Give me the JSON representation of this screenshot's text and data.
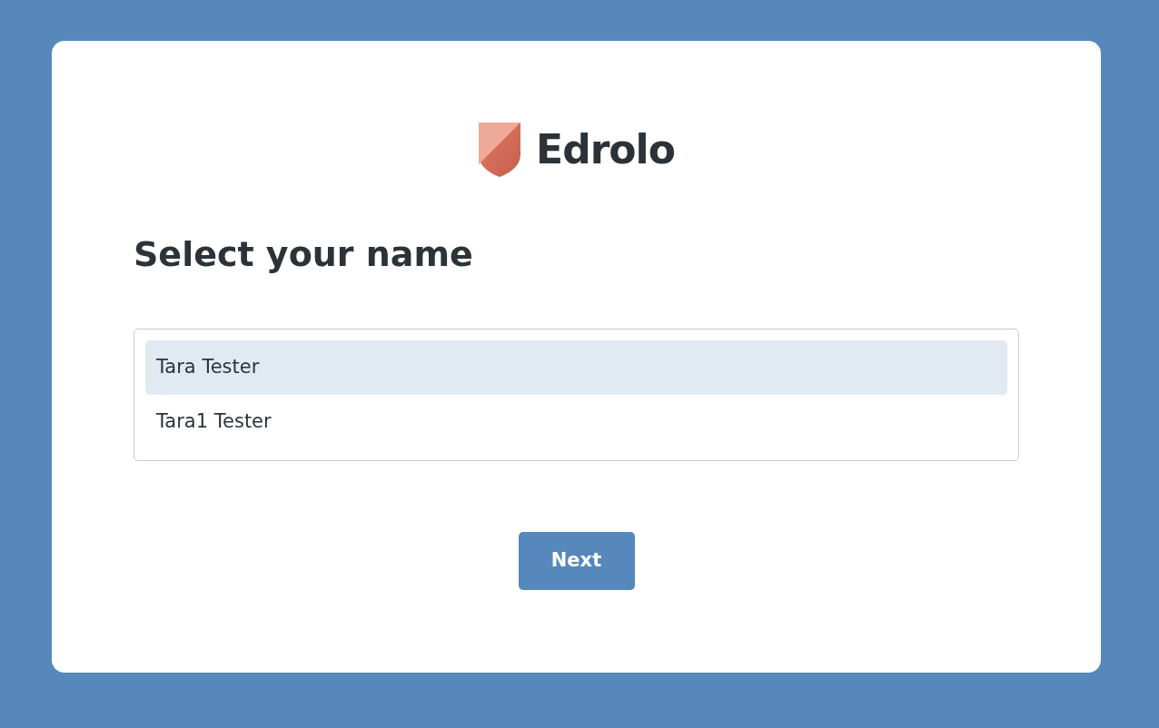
{
  "logo": {
    "text": "Edrolo"
  },
  "heading": "Select your name",
  "names": [
    {
      "label": "Tara Tester",
      "selected": true
    },
    {
      "label": "Tara1 Tester",
      "selected": false
    }
  ],
  "button": "Next"
}
